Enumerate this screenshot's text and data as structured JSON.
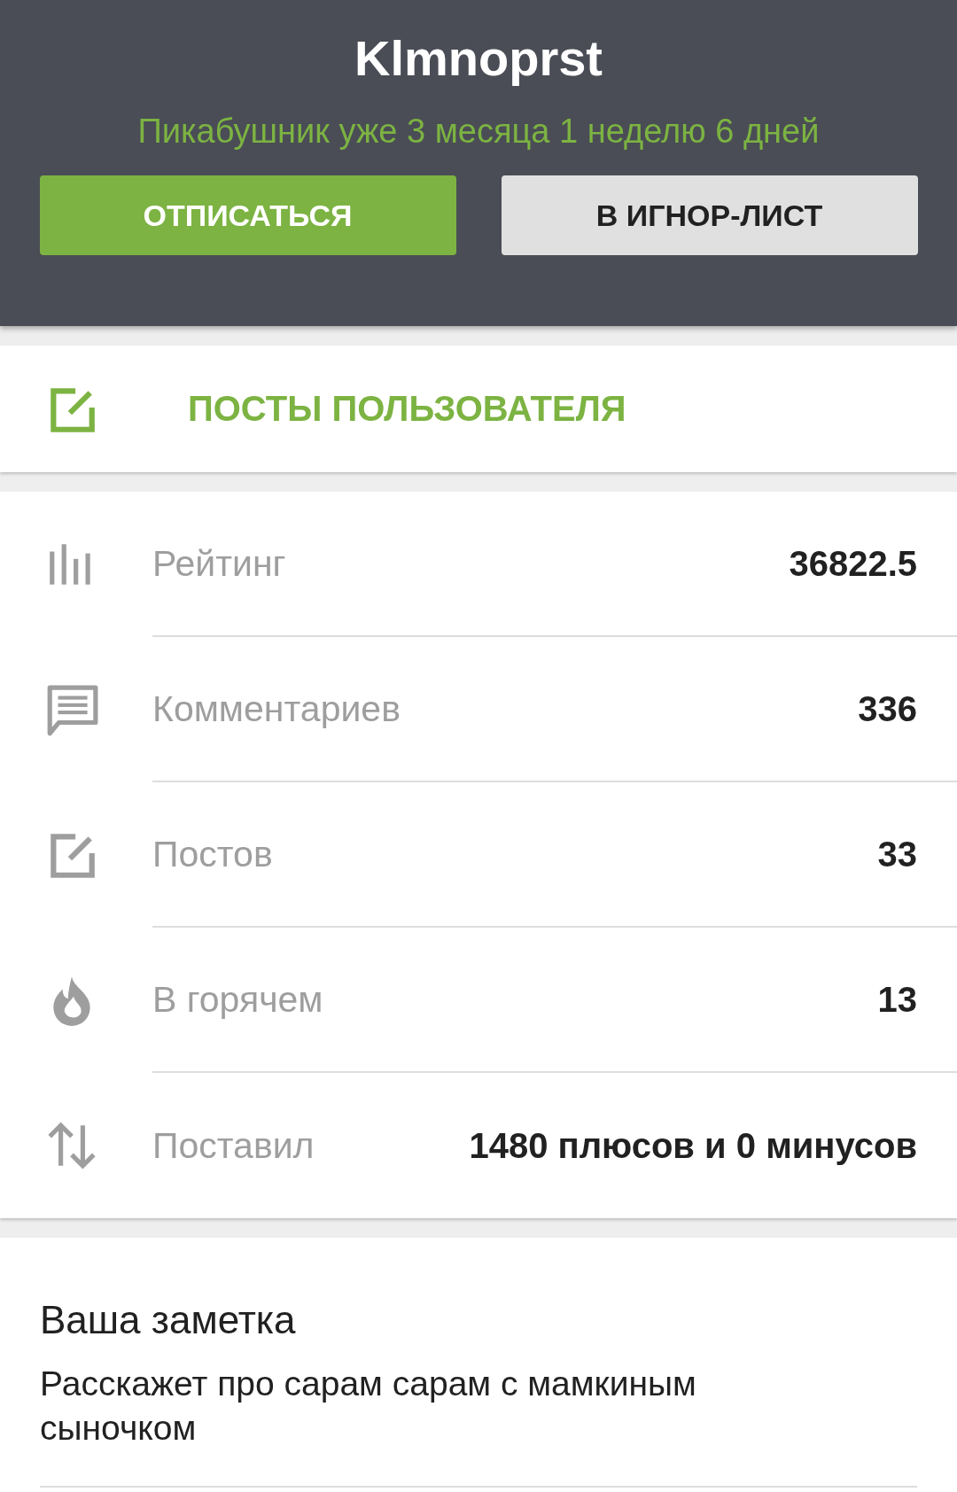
{
  "header": {
    "title": "Klmnoprst",
    "subtitle": "Пикабушник уже 3 месяца 1 неделю 6 дней",
    "buttons": [
      {
        "label": "ОТПИСАТЬСЯ",
        "kind": "primary"
      },
      {
        "label": "В ИГНОР-ЛИСТ",
        "kind": "secondary"
      }
    ]
  },
  "posts_link": {
    "label": "ПОСТЫ ПОЛЬЗОВАТЕЛЯ"
  },
  "stats": [
    {
      "kind": "rating",
      "label": "Рейтинг",
      "value": "36822.5"
    },
    {
      "kind": "comments",
      "label": "Комментариев",
      "value": "336"
    },
    {
      "kind": "posts",
      "label": "Постов",
      "value": "33"
    },
    {
      "kind": "hot",
      "label": "В горячем",
      "value": "13"
    },
    {
      "kind": "votes",
      "label": "Поставил",
      "value": "1480 плюсов и 0 минусов"
    }
  ],
  "note": {
    "title": "Ваша заметка",
    "value": "Расскажет про сарам сарам с мамкиным сыночком"
  }
}
